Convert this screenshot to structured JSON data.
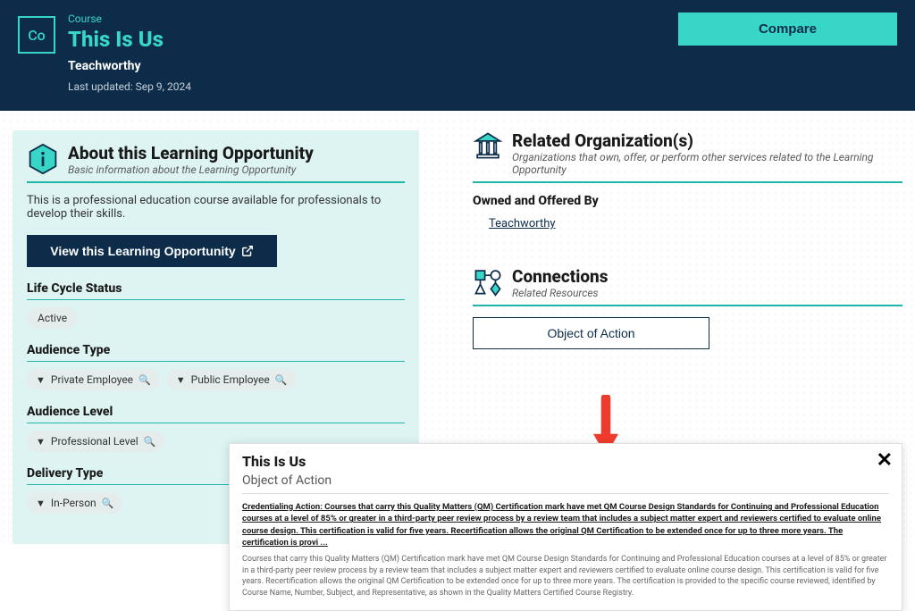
{
  "header": {
    "type_label": "Course",
    "title": "This Is Us",
    "organization": "Teachworthy",
    "last_updated_label": "Last updated: Sep 9, 2024",
    "compare_label": "Compare"
  },
  "about": {
    "title": "About this Learning Opportunity",
    "subtitle": "Basic information about the Learning Opportunity",
    "description": "This is a professional education course available for professionals to develop their skills.",
    "view_button": "View this Learning Opportunity"
  },
  "fields": {
    "life_cycle_label": "Life Cycle Status",
    "life_cycle_value": "Active",
    "audience_type_label": "Audience Type",
    "audience_type_values": [
      "Private Employee",
      "Public Employee"
    ],
    "audience_level_label": "Audience Level",
    "audience_level_value": "Professional Level",
    "delivery_type_label": "Delivery Type",
    "delivery_type_value": "In-Person"
  },
  "related": {
    "title": "Related Organization(s)",
    "subtitle": "Organizations that own, offer, or perform other services related to the Learning Opportunity",
    "owned_label": "Owned and Offered By",
    "org_name": "Teachworthy"
  },
  "connections": {
    "title": "Connections",
    "subtitle": "Related Resources",
    "object_button": "Object of Action"
  },
  "popup": {
    "title": "This Is Us",
    "subtitle": "Object of Action",
    "bold_text": "Credentialing Action: Courses that carry this Quality Matters (QM) Certification mark have met QM Course Design Standards for Continuing and Professional Education courses at a level of 85% or greater in a third-party peer review process by a review team that includes a subject matter expert and reviewers certified to evaluate online course design. This certification is valid for five years. Recertification allows the original QM Certification to be extended once for up to three more years. The certification is provi ...",
    "small_text": "Courses that carry this Quality Matters (QM) Certification mark have met QM Course Design Standards for Continuing and Professional Education courses at a level of 85% or greater in a third-party peer review process by a review team that includes a subject matter expert and reviewers certified to evaluate online course design. This certification is valid for five years. Recertification allows the original QM Certification to be extended once for up to three more years. The certification is provided to the specific course reviewed, identified by Course Name, Number, Subject, and Representative, as shown in the Quality Matters Certified Course Registry."
  }
}
